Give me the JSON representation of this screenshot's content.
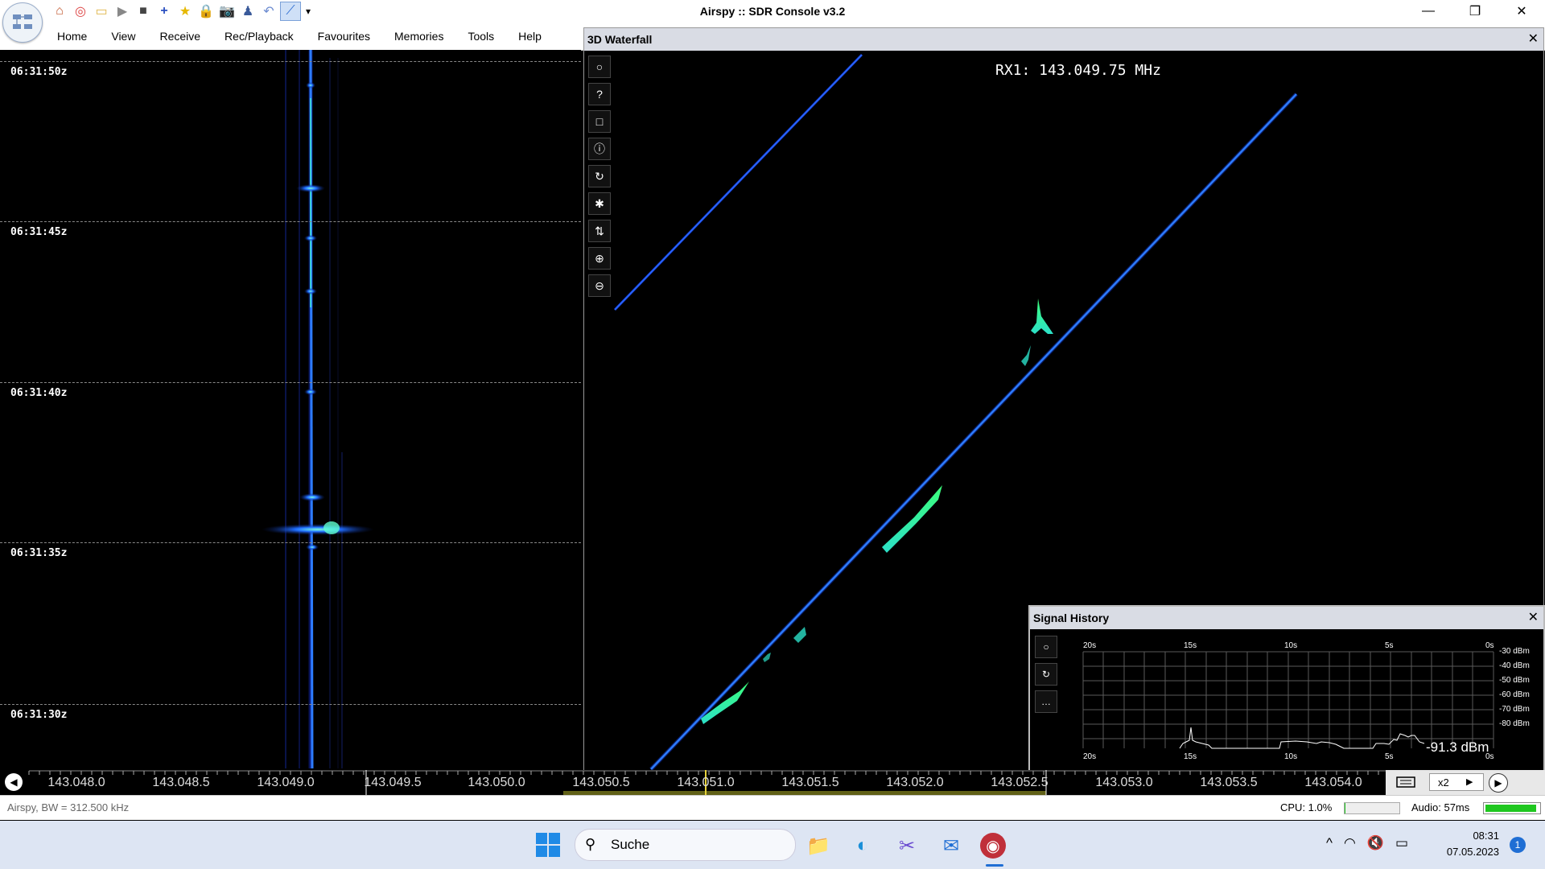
{
  "window": {
    "title": "Airspy :: SDR Console v3.2",
    "controls": {
      "minimize": "—",
      "restore": "❐",
      "close": "✕"
    }
  },
  "quick_access": [
    {
      "icon": "home-icon",
      "glyph": "⌂"
    },
    {
      "icon": "lifebuoy-icon",
      "glyph": "◎"
    },
    {
      "icon": "folder-icon",
      "glyph": "▭"
    },
    {
      "icon": "play-icon",
      "glyph": "▶"
    },
    {
      "icon": "stop-icon",
      "glyph": "■"
    },
    {
      "icon": "add-icon",
      "glyph": "+"
    },
    {
      "icon": "star-icon",
      "glyph": "★"
    },
    {
      "icon": "lock-icon",
      "glyph": "🔒"
    },
    {
      "icon": "camera-icon",
      "glyph": "📷"
    },
    {
      "icon": "person-icon",
      "glyph": "♟"
    },
    {
      "icon": "undo-icon",
      "glyph": "↶"
    },
    {
      "icon": "chart-icon",
      "glyph": "⟋"
    },
    {
      "icon": "dropdown-icon",
      "glyph": "▾"
    }
  ],
  "menu": [
    "Home",
    "View",
    "Receive",
    "Rec/Playback",
    "Favourites",
    "Memories",
    "Tools",
    "Help"
  ],
  "waterfall": {
    "times": [
      "06:31:50z",
      "06:31:45z",
      "06:31:40z",
      "06:31:35z",
      "06:31:30z"
    ]
  },
  "panel3d": {
    "title": "3D Waterfall",
    "close": "✕",
    "rx_label": "RX1: 143.049.75 MHz",
    "tools": [
      {
        "icon": "circle-icon",
        "glyph": "○"
      },
      {
        "icon": "help-icon",
        "glyph": "?"
      },
      {
        "icon": "square-icon",
        "glyph": "□"
      },
      {
        "icon": "info-icon",
        "glyph": "ⓘ"
      },
      {
        "icon": "rotate-icon",
        "glyph": "↻"
      },
      {
        "icon": "asterisk-icon",
        "glyph": "✱"
      },
      {
        "icon": "sort-icon",
        "glyph": "⇅"
      },
      {
        "icon": "zoom-in-icon",
        "glyph": "⊕"
      },
      {
        "icon": "zoom-out-icon",
        "glyph": "⊖"
      }
    ]
  },
  "signal_history": {
    "title": "Signal History",
    "close": "✕",
    "x_labels": [
      "20s",
      "15s",
      "10s",
      "5s",
      "0s"
    ],
    "y_labels": [
      "-30 dBm",
      "-40 dBm",
      "-50 dBm",
      "-60 dBm",
      "-70 dBm",
      "-80 dBm"
    ],
    "readout": "-91.3 dBm",
    "tools": [
      {
        "icon": "circle-icon",
        "glyph": "○"
      },
      {
        "icon": "refresh-icon",
        "glyph": "↻"
      },
      {
        "icon": "more-icon",
        "glyph": "…"
      }
    ]
  },
  "freq_scale": {
    "labels": [
      "143.048.0",
      "143.048.5",
      "143.049.0",
      "143.049.5",
      "143.050.0",
      "143.050.5",
      "143.051.0",
      "143.051.5",
      "143.052.0",
      "143.052.5",
      "143.053.0",
      "143.053.5",
      "143.054.0"
    ],
    "zoom": "x2",
    "zoom_arrow": "▶",
    "left_button": "◀",
    "right_button": "▶"
  },
  "status": {
    "left": "Airspy, BW = 312.500 kHz",
    "cpu": "CPU: 1.0%",
    "cpu_level": 0.01,
    "audio": "Audio: 57ms",
    "audio_level": 0.95
  },
  "taskbar": {
    "search_placeholder": "Suche",
    "apps": [
      {
        "icon": "file-explorer-icon",
        "glyph": "📁"
      },
      {
        "icon": "edge-icon",
        "glyph": "◐"
      },
      {
        "icon": "snipping-tool-icon",
        "glyph": "✂"
      },
      {
        "icon": "mail-icon",
        "glyph": "✉"
      },
      {
        "icon": "sdr-console-icon",
        "glyph": "◉"
      }
    ],
    "tray": [
      {
        "icon": "chevron-up-icon",
        "glyph": "^"
      },
      {
        "icon": "wifi-icon",
        "glyph": "◠"
      },
      {
        "icon": "speaker-muted-icon",
        "glyph": "🔇"
      },
      {
        "icon": "battery-icon",
        "glyph": "▭"
      }
    ],
    "time": "08:31",
    "date": "07.05.2023",
    "notifications": "1"
  },
  "colors": {
    "signal_blue": "#1e6bff",
    "signal_cyan": "#2ce0c8",
    "peak_green": "#3cff7a",
    "grid": "#888888"
  }
}
